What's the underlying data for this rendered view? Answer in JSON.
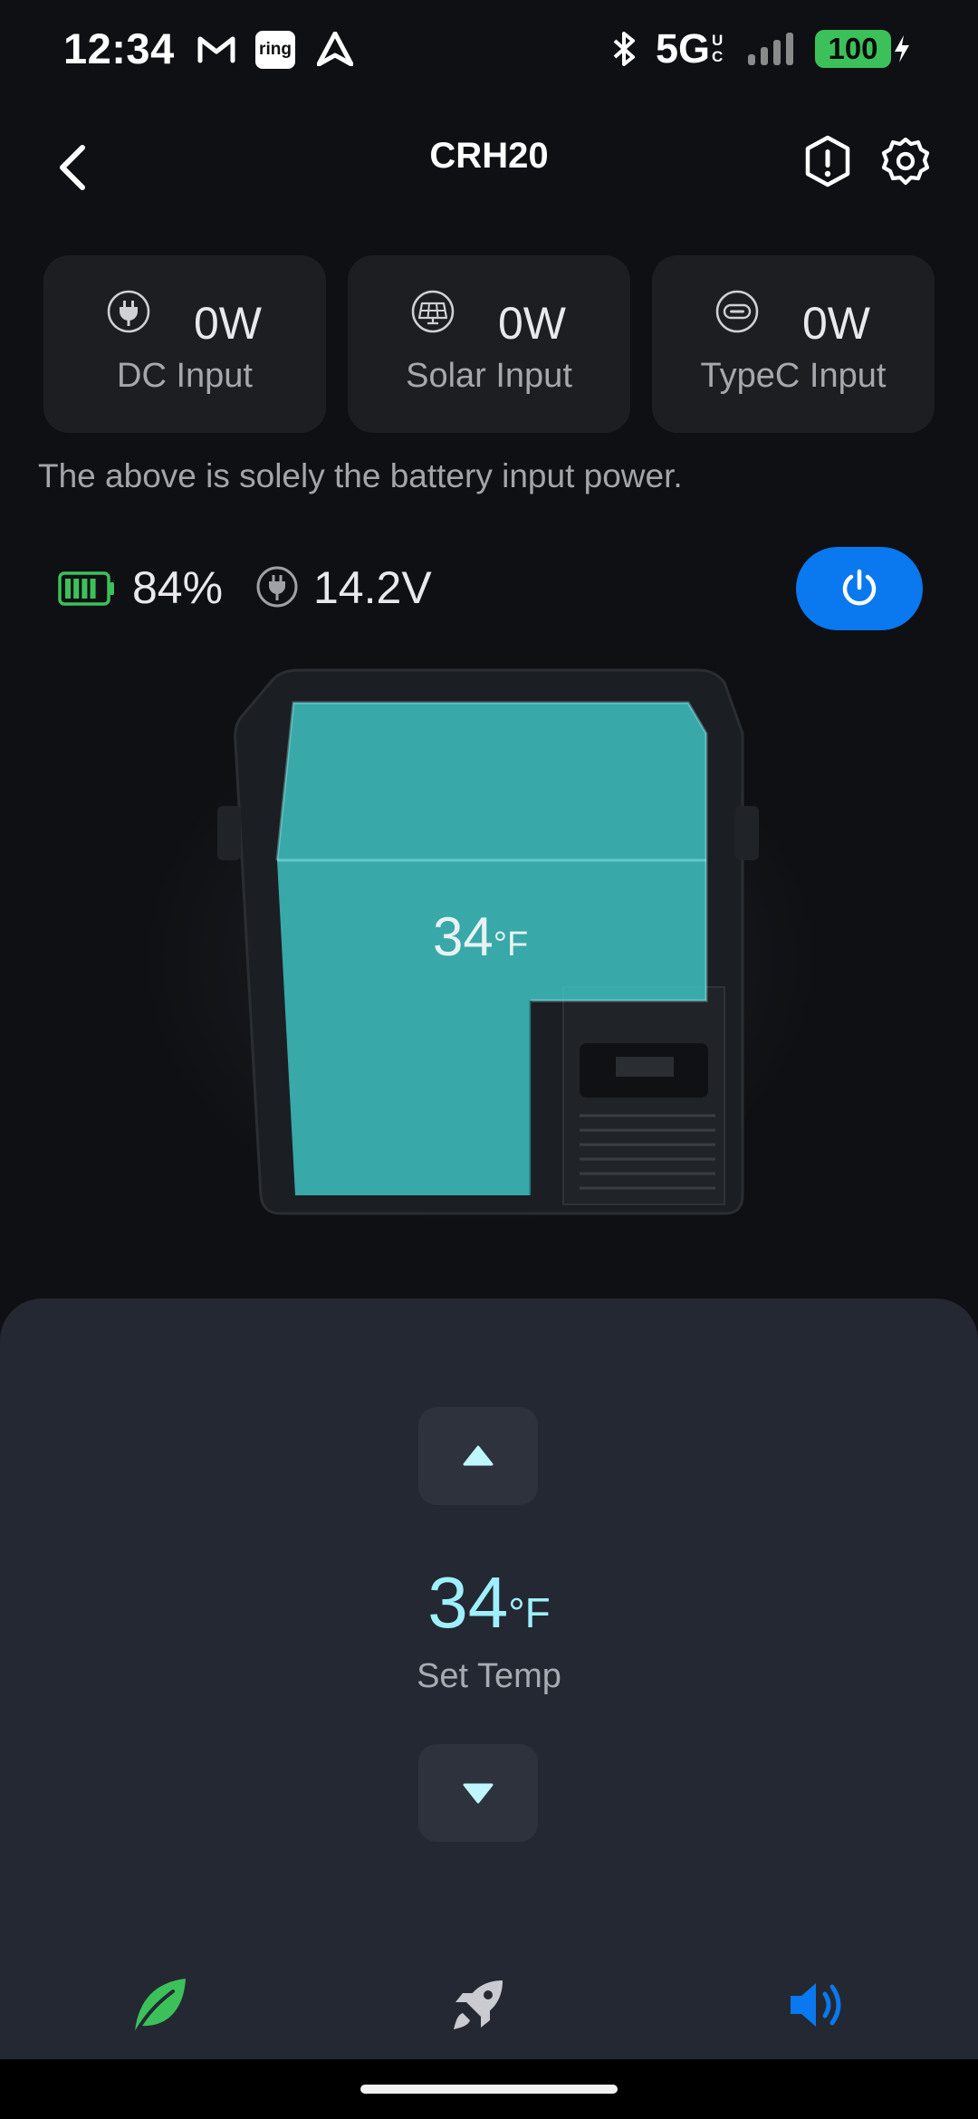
{
  "status_bar": {
    "time": "12:34",
    "ring_label": "ring",
    "network": "5G",
    "network_sub": "UC",
    "battery": "100",
    "icons": [
      "gmail-icon",
      "ring-icon",
      "navigation-icon",
      "bluetooth-icon",
      "signal-icon",
      "battery-charging-icon"
    ]
  },
  "header": {
    "title": "CRH20",
    "icons": [
      "back-icon",
      "alert-icon",
      "settings-icon"
    ]
  },
  "inputs": [
    {
      "value": "0W",
      "label": "DC Input",
      "icon": "plug-icon"
    },
    {
      "value": "0W",
      "label": "Solar Input",
      "icon": "solar-panel-icon"
    },
    {
      "value": "0W",
      "label": "TypeC Input",
      "icon": "usb-c-icon"
    }
  ],
  "note": "The above is solely the battery input power.",
  "battery": {
    "percent": "84%",
    "voltage": "14.2V",
    "level": 0.84,
    "color": "#3cc15a"
  },
  "power_button": {
    "icon": "power-icon",
    "color": "#0a78ee"
  },
  "fridge": {
    "temp_value": "34",
    "temp_unit": "°F",
    "zone_color": "#3fc7c7"
  },
  "control": {
    "set_temp_value": "34",
    "set_temp_unit": "°F",
    "set_temp_label": "Set Temp",
    "up_icon": "triangle-up-icon",
    "down_icon": "triangle-down-icon",
    "accent": "#9ff0ff"
  },
  "modes": [
    {
      "icon": "leaf-icon",
      "color": "#3cc15a"
    },
    {
      "icon": "rocket-icon",
      "color": "#c9cbd0"
    },
    {
      "icon": "speaker-icon",
      "color": "#0a78ee"
    }
  ]
}
